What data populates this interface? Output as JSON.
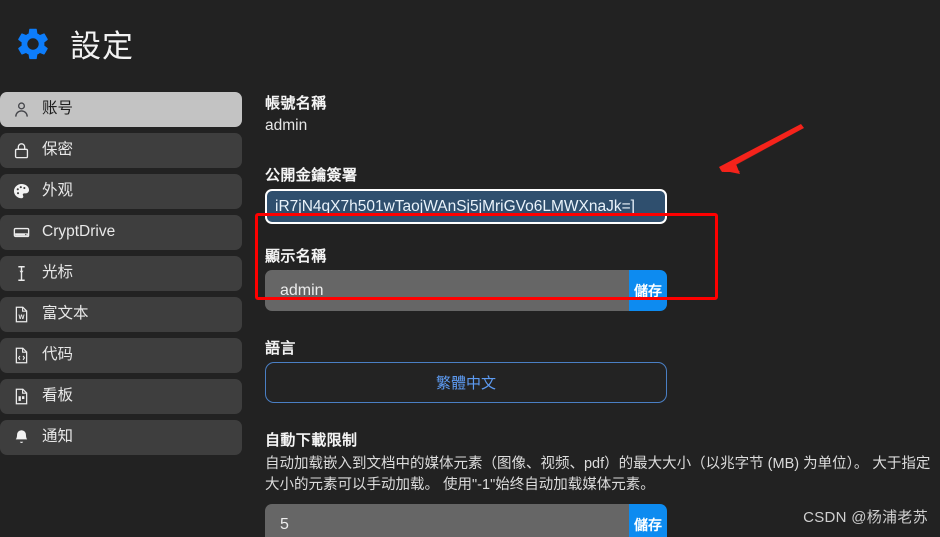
{
  "header": {
    "title": "設定",
    "gear_icon": "gear-icon",
    "accent": "#0d8bf0"
  },
  "sidebar": {
    "items": [
      {
        "label": "账号",
        "icon": "user-icon",
        "active": true
      },
      {
        "label": "保密",
        "icon": "lock-icon",
        "active": false
      },
      {
        "label": "外观",
        "icon": "palette-icon",
        "active": false
      },
      {
        "label": "CryptDrive",
        "icon": "hard-drive-icon",
        "active": false
      },
      {
        "label": "光标",
        "icon": "text-cursor-icon",
        "active": false
      },
      {
        "label": "富文本",
        "icon": "file-word-icon",
        "active": false
      },
      {
        "label": "代码",
        "icon": "file-code-icon",
        "active": false
      },
      {
        "label": "看板",
        "icon": "file-board-icon",
        "active": false
      },
      {
        "label": "通知",
        "icon": "bell-icon",
        "active": false
      }
    ]
  },
  "main": {
    "account_name": {
      "label": "帳號名稱",
      "value": "admin"
    },
    "public_key": {
      "label": "公開金鑰簽署",
      "value": "iR7jN4qX7h501wTaojWAnSj5jMriGVo6LMWXnaJk=]",
      "selected": true,
      "selection_color": "#2f4f6e"
    },
    "display_name": {
      "label": "顯示名稱",
      "value": "admin",
      "placeholder": "admin",
      "save_label": "儲存"
    },
    "language": {
      "label": "語言",
      "selected": "繁體中文",
      "options": [
        "繁體中文"
      ]
    },
    "autodownload": {
      "label": "自動下載限制",
      "description": "自动加载嵌入到文档中的媒体元素（图像、视频、pdf）的最大大小（以兆字节 (MB) 为单位）。 大于指定大小的元素可以手动加载。 使用\"-1\"始终自动加载媒体元素。",
      "value": "5",
      "save_label": "儲存"
    }
  },
  "annotations": {
    "highlight_color": "#fe0000",
    "arrow_color": "#f5231b",
    "arrow_name": "red-arrow-pointer"
  },
  "watermark": {
    "text": "CSDN @杨浦老苏"
  }
}
